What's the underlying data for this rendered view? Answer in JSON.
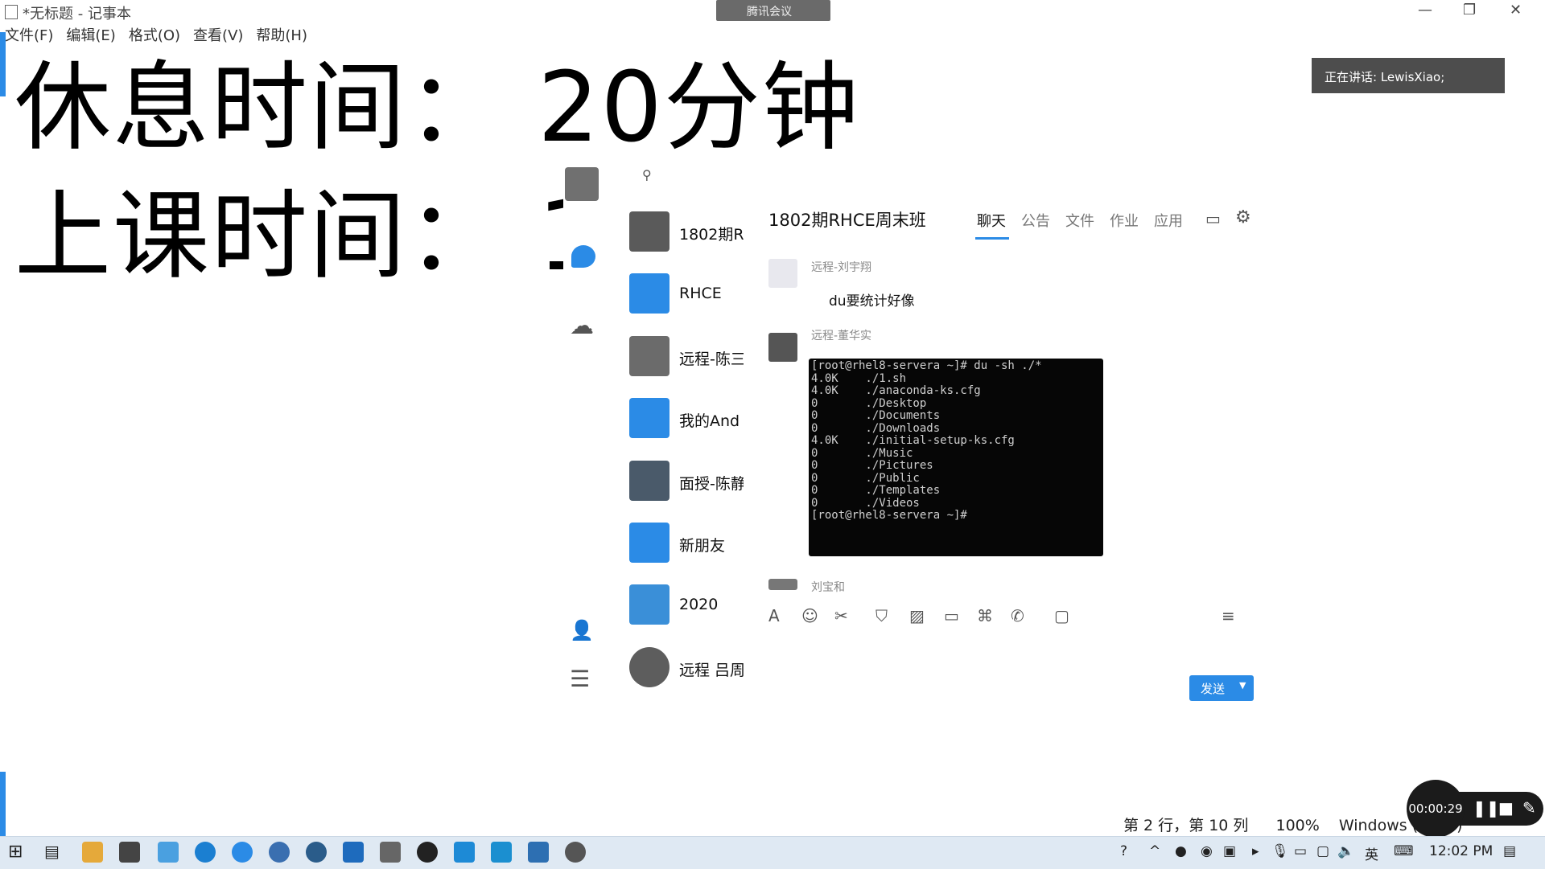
{
  "notepad": {
    "title": "*无标题 - 记事本",
    "menu": [
      "文件(F)",
      "编辑(E)",
      "格式(O)",
      "查看(V)",
      "帮助(H)"
    ],
    "line1": "休息时间：  20分钟",
    "line2": "上课时间：  1",
    "status": {
      "position": "第 2 行，第 10 列",
      "zoom": "100%",
      "encoding": "Windows (CRLF)"
    }
  },
  "meeting": {
    "pill_label": "腾讯会议",
    "speaker": "正在讲话: LewisXiao;"
  },
  "qq": {
    "contacts": [
      {
        "name": "1802期R",
        "color": "#5a5a5a"
      },
      {
        "name": "RHCE",
        "color": "#2b8be6"
      },
      {
        "name": "远程-陈三",
        "color": "#6b6b6b"
      },
      {
        "name": "我的And",
        "color": "#2b8be6"
      },
      {
        "name": "面授-陈静",
        "color": "#4a5a6a"
      },
      {
        "name": "新朋友",
        "color": "#2b8be6"
      },
      {
        "name": "2020",
        "color": "#3a8fd8"
      },
      {
        "name": "远程 吕周",
        "color": "#5d5d5d"
      }
    ],
    "chat_title": "1802期RHCE周末班",
    "tabs": [
      "聊天",
      "公告",
      "文件",
      "作业",
      "应用"
    ],
    "messages": [
      {
        "sender": "远程-刘宇翔",
        "text": "du要统计好像"
      },
      {
        "sender": "远程-董华实",
        "image": "terminal"
      }
    ],
    "terminal_lines": [
      "[root@rhel8-servera ~]# du -sh ./*",
      "4.0K    ./1.sh",
      "4.0K    ./anaconda-ks.cfg",
      "0       ./Desktop",
      "0       ./Documents",
      "0       ./Downloads",
      "4.0K    ./initial-setup-ks.cfg",
      "0       ./Music",
      "0       ./Pictures",
      "0       ./Public",
      "0       ./Templates",
      "0       ./Videos",
      "[root@rhel8-servera ~]#"
    ],
    "last_sender": "刘宝和",
    "send_label": "发送"
  },
  "recorder": {
    "time": "00:00:29"
  },
  "taskbar": {
    "ime": "英",
    "time": "12:02 PM"
  },
  "colors": {
    "accent": "#2b8be6",
    "terminal_bg": "#060606"
  }
}
